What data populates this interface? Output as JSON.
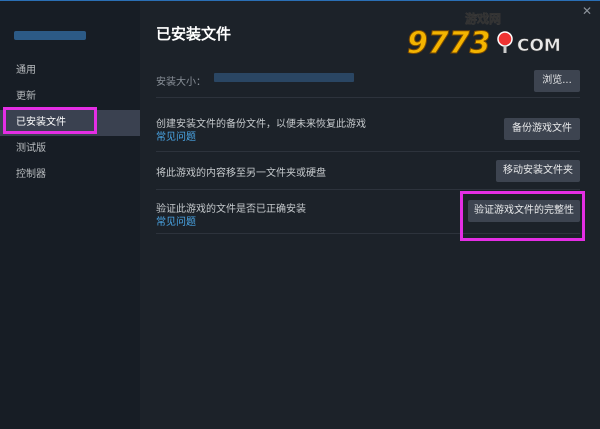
{
  "sidebar": {
    "items": [
      {
        "label": "通用",
        "active": false
      },
      {
        "label": "更新",
        "active": false
      },
      {
        "label": "已安装文件",
        "active": true
      },
      {
        "label": "测试版",
        "active": false
      },
      {
        "label": "控制器",
        "active": false
      }
    ]
  },
  "main": {
    "title": "已安装文件",
    "size_label": "安装大小：",
    "browse_button": "浏览...",
    "rows": [
      {
        "text": "创建安装文件的备份文件，以便未来恢复此游戏",
        "link": "常见问题",
        "button": "备份游戏文件"
      },
      {
        "text": "将此游戏的内容移至另一文件夹或硬盘",
        "link": "",
        "button": "移动安装文件夹"
      },
      {
        "text": "验证此游戏的文件是否已正确安装",
        "link": "常见问题",
        "button": "验证游戏文件的完整性"
      }
    ]
  },
  "watermark": {
    "text_top": "游戏网",
    "text_main": "9773",
    "text_com": "COM"
  },
  "colors": {
    "highlight": "#e42ee4",
    "link": "#4aa6e6",
    "accent": "#2a6fb5"
  }
}
